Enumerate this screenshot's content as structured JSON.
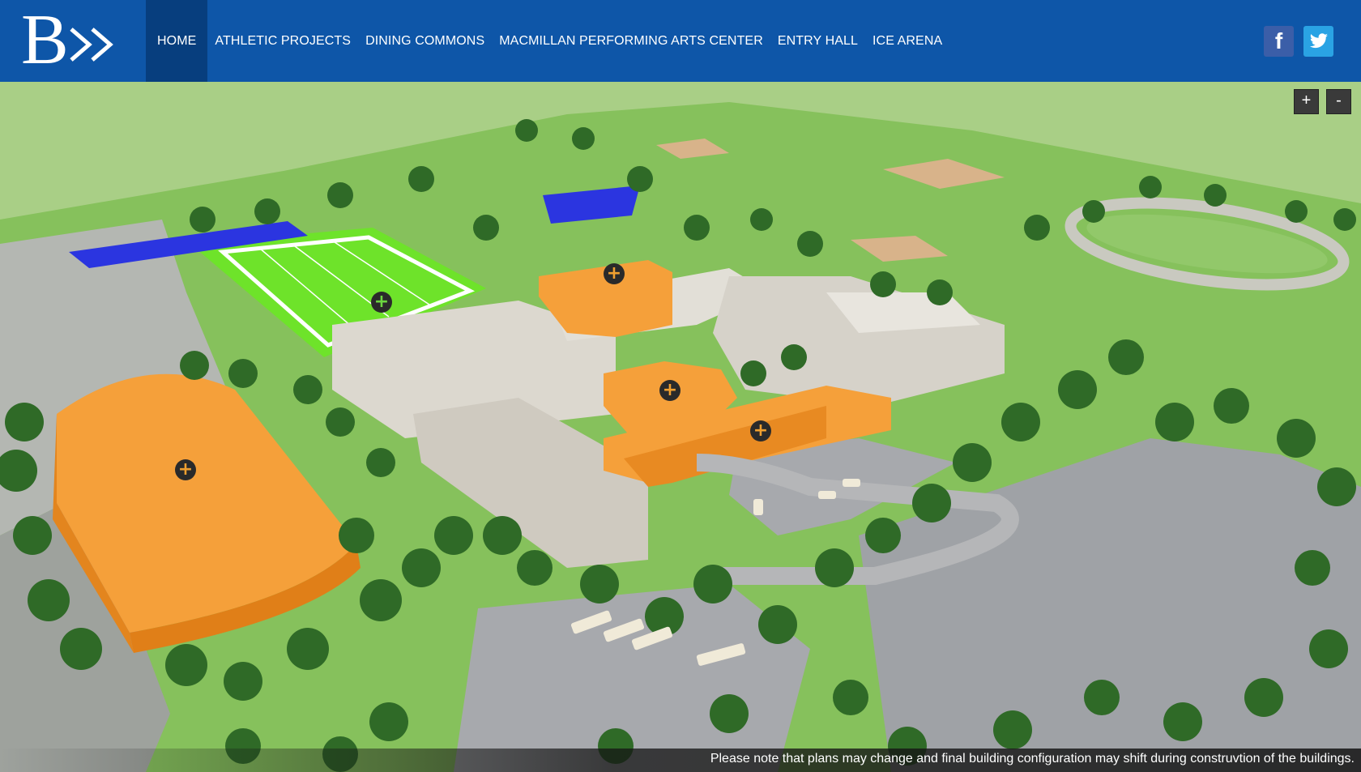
{
  "header": {
    "logo_letter": "B",
    "nav": [
      {
        "label": "HOME",
        "active": true
      },
      {
        "label": "ATHLETIC PROJECTS"
      },
      {
        "label": "DINING COMMONS"
      },
      {
        "label": "MACMILLAN PERFORMING ARTS CENTER"
      },
      {
        "label": "ENTRY HALL"
      },
      {
        "label": "ICE ARENA"
      }
    ],
    "social": {
      "facebook_glyph": "f",
      "facebook_icon": "facebook-icon",
      "twitter_icon": "twitter-icon"
    }
  },
  "map": {
    "zoom_in_label": "+",
    "zoom_out_label": "-",
    "marker_glyph": "+",
    "colors": {
      "highlight": "#f5a03a",
      "building": "#dcd8cf",
      "grass": "#7ec45a",
      "field": "#4cc62c",
      "court": "#2b35e0",
      "pavement": "#aeb0b4"
    }
  },
  "footer": {
    "note": "Please note that plans may change and final building configuration may shift during construvtion of the buildings."
  }
}
